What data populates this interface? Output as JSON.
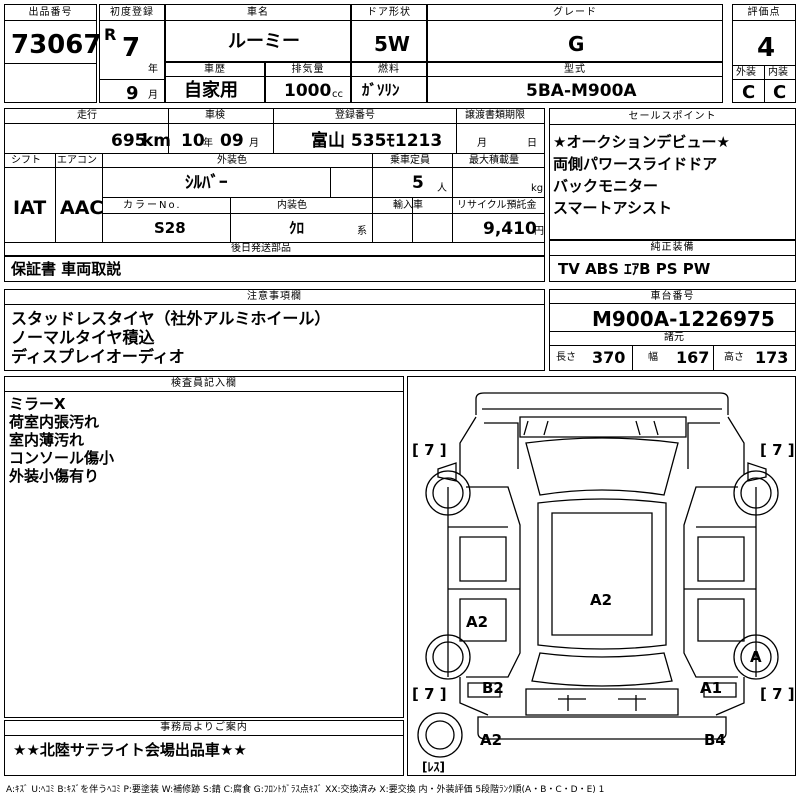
{
  "header": {
    "lot_label": "出品番号",
    "lot_no": "73067",
    "first_reg_label": "初度登録",
    "era": "R",
    "year": "7",
    "year_unit": "年",
    "month": "9",
    "month_unit": "月",
    "car_name_label": "車名",
    "car_name": "ルーミー",
    "door_label": "ドア形状",
    "door": "5W",
    "grade_label": "グレード",
    "grade": "G",
    "score_label": "評価点",
    "score": "4",
    "history_label": "車歴",
    "history": "自家用",
    "displacement_label": "排気量",
    "displacement": "1000",
    "displacement_unit": "cc",
    "fuel_label": "燃料",
    "fuel": "ｶﾞｿﾘﾝ",
    "model_label": "型式",
    "model": "5BA-M900A",
    "exterior_label": "外装",
    "exterior": "C",
    "interior_label": "内装",
    "interior": "C"
  },
  "details": {
    "mileage_label": "走行",
    "mileage": "695",
    "mileage_unit": "km",
    "inspection_label": "車検",
    "insp_year": "10",
    "insp_year_unit": "年",
    "insp_month": "09",
    "insp_month_unit": "月",
    "plate_label": "登録番号",
    "plate": "富山 535ﾓ1213",
    "transfer_label": "譲渡書類期限",
    "transfer_month_unit": "月",
    "transfer_day_unit": "日",
    "shift_label": "シフト",
    "shift": "IAT",
    "ac_label": "エアコン",
    "ac": "AAC",
    "color_label": "外装色",
    "color": "ｼﾙﾊﾞｰ",
    "capacity_label": "乗車定員",
    "capacity": "5",
    "capacity_unit": "人",
    "max_load_label": "最大積載量",
    "max_load_unit": "kg",
    "color_no_label": "カラーNo.",
    "color_no": "S28",
    "interior_color_label": "内装色",
    "interior_color": "ｸﾛ",
    "interior_color_unit": "系",
    "import_label": "輸入車",
    "recycle_label": "リサイクル預託金",
    "recycle": "9,410",
    "recycle_unit": "円",
    "later_label": "後日発送部品",
    "later_value": "保証書 車両取説"
  },
  "sales": {
    "label": "セールスポイント",
    "items": [
      "★オークションデビュー★",
      "両側パワースライドドア",
      "バックモニター",
      "スマートアシスト"
    ]
  },
  "equipment": {
    "label": "純正装備",
    "value": "TV ABS ｴｱB PS PW"
  },
  "notes": {
    "label": "注意事項欄",
    "lines": [
      "スタッドレスタイヤ（社外アルミホイール）",
      "ノーマルタイヤ積込",
      "ディスプレイオーディオ"
    ]
  },
  "chassis": {
    "label": "車台番号",
    "value": "M900A-1226975",
    "spec_label": "諸元",
    "length_label": "長さ",
    "length": "370",
    "width_label": "幅",
    "width": "167",
    "height_label": "高さ",
    "height": "173"
  },
  "inspector": {
    "label": "検査員記入欄",
    "lines": [
      "ミラーX",
      "荷室内張汚れ",
      "室内薄汚れ",
      "コンソール傷小",
      "外装小傷有り"
    ]
  },
  "diagram": {
    "tire_fl": "[ 7 ]",
    "tire_fr": "[ 7 ]",
    "tire_rl": "[ 7 ]",
    "tire_rr": "[ 7 ]",
    "spare": "[ﾚｽ]",
    "mark_roof": "A2",
    "mark_left_door": "A2",
    "mark_right_wheel": "A",
    "mark_rear_left": "B2",
    "mark_rear_right": "A1",
    "mark_bumper_left": "A2",
    "mark_bumper_right": "B4"
  },
  "office": {
    "label": "事務局よりご案内",
    "value": "★★北陸サテライト会場出品車★★"
  },
  "legend": "A:ｷｽﾞ U:ﾍｺﾐ B:ｷｽﾞを伴うﾍｺﾐ P:要塗装 W:補修跡 S:錆 C:腐食 G:ﾌﾛﾝﾄｶﾞﾗｽ点ｷｽﾞ XX:交換済み X:要交換 内・外装評価 5段階ﾗﾝｸ順(A・B・C・D・E) 1"
}
